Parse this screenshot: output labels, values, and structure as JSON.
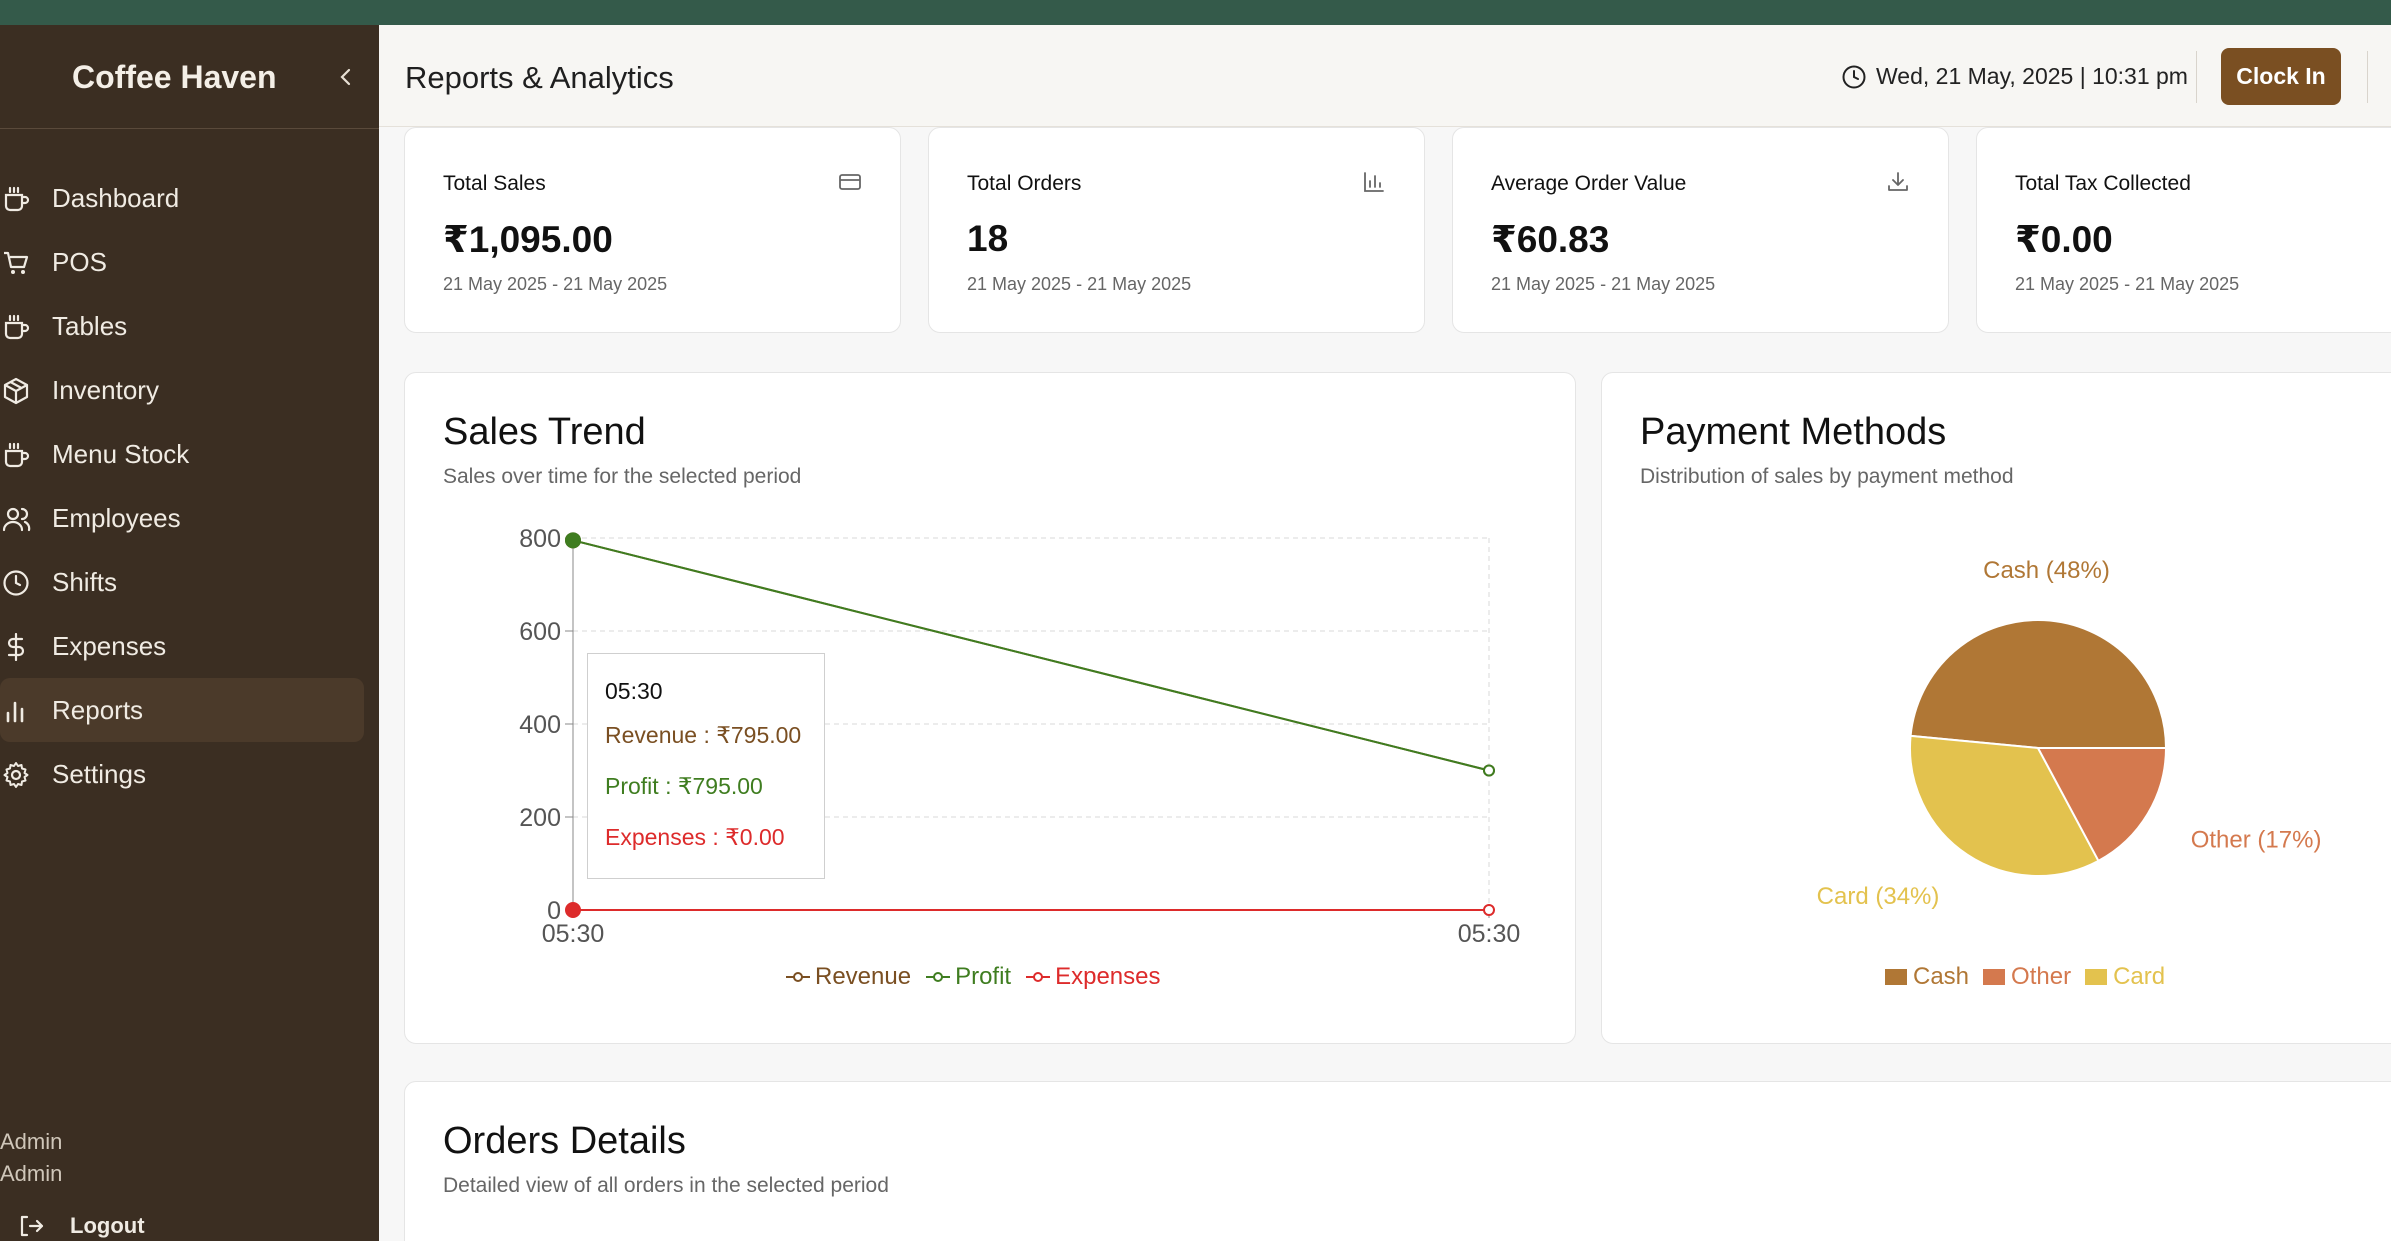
{
  "app": {
    "brand": "Coffee Haven",
    "collapse_icon": "chevron-left-icon"
  },
  "sidebar": {
    "items": [
      {
        "label": "Dashboard",
        "icon": "coffee-cup-icon",
        "active": false
      },
      {
        "label": "POS",
        "icon": "shopping-cart-icon",
        "active": false
      },
      {
        "label": "Tables",
        "icon": "coffee-cup-icon",
        "active": false
      },
      {
        "label": "Inventory",
        "icon": "package-icon",
        "active": false
      },
      {
        "label": "Menu Stock",
        "icon": "coffee-cup-icon",
        "active": false
      },
      {
        "label": "Employees",
        "icon": "users-icon",
        "active": false
      },
      {
        "label": "Shifts",
        "icon": "clock-icon",
        "active": false
      },
      {
        "label": "Expenses",
        "icon": "dollar-icon",
        "active": false
      },
      {
        "label": "Reports",
        "icon": "bar-chart-icon",
        "active": true
      },
      {
        "label": "Settings",
        "icon": "gear-icon",
        "active": false
      }
    ],
    "user_name": "Admin",
    "user_role": "Admin",
    "logout_label": "Logout"
  },
  "header": {
    "title": "Reports & Analytics",
    "datetime": "Wed, 21 May, 2025 | 10:31 pm",
    "clock_in_label": "Clock In"
  },
  "stats": [
    {
      "title": "Total Sales",
      "value": "₹1,095.00",
      "range": "21 May 2025 - 21 May 2025",
      "icon": "credit-card-icon"
    },
    {
      "title": "Total Orders",
      "value": "18",
      "range": "21 May 2025 - 21 May 2025",
      "icon": "bar-chart-icon"
    },
    {
      "title": "Average Order Value",
      "value": "₹60.83",
      "range": "21 May 2025 - 21 May 2025",
      "icon": "download-icon"
    },
    {
      "title": "Total Tax Collected",
      "value": "₹0.00",
      "range": "21 May 2025 - 21 May 2025",
      "icon": "none"
    }
  ],
  "sales_trend": {
    "title": "Sales Trend",
    "subtitle": "Sales over time for the selected period",
    "tooltip": {
      "label": "05:30",
      "revenue": "Revenue : ₹795.00",
      "profit": "Profit : ₹795.00",
      "expenses": "Expenses : ₹0.00"
    }
  },
  "payment_methods": {
    "title": "Payment Methods",
    "subtitle": "Distribution of sales by payment method"
  },
  "orders": {
    "title": "Orders Details",
    "subtitle": "Detailed view of all orders in the selected period"
  },
  "colors": {
    "revenue": "#7a4f22",
    "profit": "#3f7d20",
    "expenses": "#dd2b2b",
    "cash": "#b07735",
    "other": "#d4794e",
    "card": "#e3c24e"
  },
  "chart_data": [
    {
      "type": "line",
      "x": [
        "05:30",
        "05:30"
      ],
      "ylim": [
        0,
        800
      ],
      "yticks": [
        0,
        200,
        400,
        600,
        800
      ],
      "series": [
        {
          "name": "Revenue",
          "values": [
            795,
            300
          ]
        },
        {
          "name": "Profit",
          "values": [
            795,
            300
          ]
        },
        {
          "name": "Expenses",
          "values": [
            0,
            0
          ]
        }
      ],
      "grid": true,
      "legend": "bottom"
    },
    {
      "type": "pie",
      "slices": [
        {
          "name": "Cash",
          "value": 48,
          "label": "Cash (48%)"
        },
        {
          "name": "Card",
          "value": 34,
          "label": "Card (34%)"
        },
        {
          "name": "Other",
          "value": 17,
          "label": "Other (17%)"
        }
      ],
      "legend": "bottom"
    }
  ]
}
